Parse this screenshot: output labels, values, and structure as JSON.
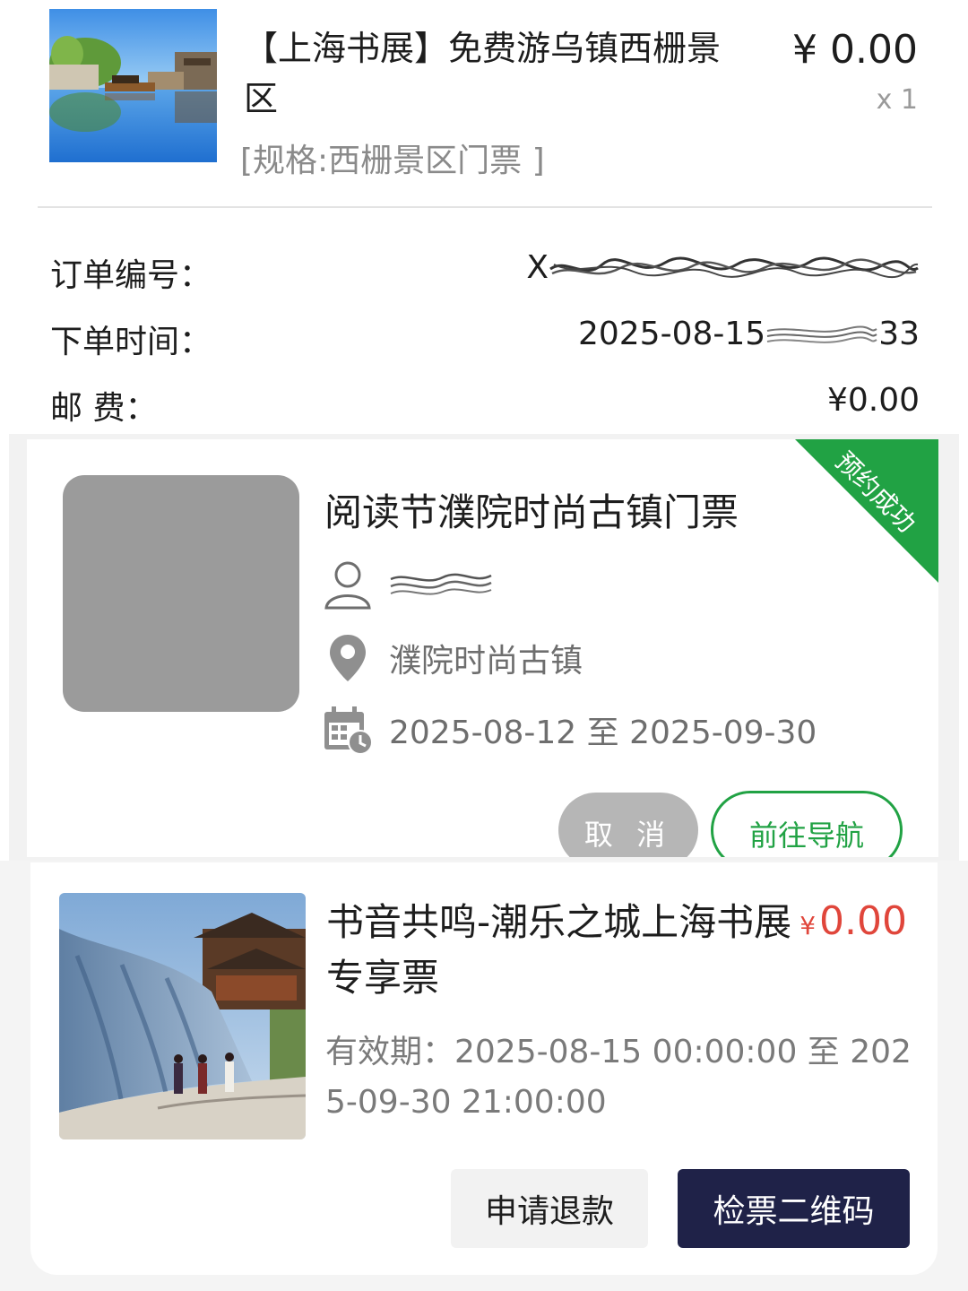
{
  "order": {
    "product_title": "【上海书展】免费游乌镇西栅景区",
    "spec": "[规格:西栅景区门票 ]",
    "price": "¥ 0.00",
    "quantity": "x 1",
    "rows": [
      {
        "label": "订单编号：",
        "value_prefix": "X",
        "value_suffix": ""
      },
      {
        "label": "下单时间：",
        "value_prefix": "2025-08-15",
        "value_suffix": "33"
      },
      {
        "label": "邮 费：",
        "value_prefix": "¥0.00",
        "value_suffix": ""
      }
    ]
  },
  "reservation": {
    "badge": "预约成功",
    "title": "阅读节濮院时尚古镇门票",
    "location": "濮院时尚古镇",
    "date_range": "2025-08-12 至 2025-09-30",
    "cancel_label": "取 消",
    "navigate_label": "前往导航",
    "accent_color": "#21a244"
  },
  "ticket": {
    "title": "书音共鸣-潮乐之城上海书展专享票",
    "price_symbol": "¥",
    "price_value": "0.00",
    "validity": "有效期：2025-08-15 00:00:00 至 2025-09-30 21:00:00",
    "refund_label": "申请退款",
    "qr_label": "检票二维码",
    "price_color": "#e0463b",
    "qr_button_color": "#1f2248"
  },
  "icons": {
    "user": "user-icon",
    "location": "location-pin-icon",
    "calendar": "calendar-clock-icon"
  }
}
